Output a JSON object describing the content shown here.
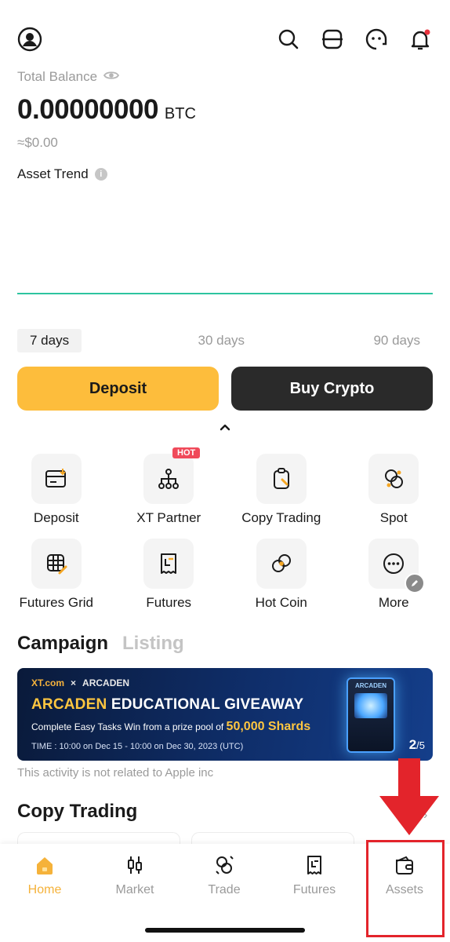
{
  "header": {
    "icons": [
      "profile-icon",
      "search-icon",
      "scan-icon",
      "support-icon",
      "notification-icon"
    ]
  },
  "balance": {
    "label": "Total Balance",
    "value": "0.00000000",
    "unit": "BTC",
    "fiat": "≈$0.00"
  },
  "trend": {
    "label": "Asset Trend",
    "info": "i",
    "ranges": [
      "7 days",
      "30 days",
      "90 days"
    ],
    "active_range": "7 days",
    "line_color": "#2ec4a0"
  },
  "actions": {
    "deposit": "Deposit",
    "buy": "Buy Crypto",
    "deposit_color": "#fdbd3c",
    "buy_color": "#2a2a2a"
  },
  "shortcuts": [
    {
      "label": "Deposit",
      "icon": "deposit-card-icon"
    },
    {
      "label": "XT Partner",
      "icon": "partner-network-icon",
      "badge": "HOT"
    },
    {
      "label": "Copy Trading",
      "icon": "copy-trading-icon"
    },
    {
      "label": "Spot",
      "icon": "spot-coins-icon"
    },
    {
      "label": "Futures Grid",
      "icon": "futures-grid-icon"
    },
    {
      "label": "Futures",
      "icon": "futures-icon"
    },
    {
      "label": "Hot Coin",
      "icon": "hot-coin-icon"
    },
    {
      "label": "More",
      "icon": "more-icon"
    }
  ],
  "sections": {
    "campaign": "Campaign",
    "listing": "Listing"
  },
  "banner": {
    "brand_left": "XT.com",
    "brand_sep": "×",
    "brand_right": "ARCADEN",
    "headline_a": "ARCADEN",
    "headline_b": " EDUCATIONAL GIVEAWAY",
    "sub_text": "Complete Easy Tasks  Win from a prize pool of ",
    "sub_big": "50,000 Shards",
    "time": "TIME : 10:00 on Dec 15 - 10:00 on Dec 30, 2023 (UTC)",
    "pager_current": "2",
    "pager_total": "/5",
    "machine_logo": "ARCADEN"
  },
  "disclaimer": "This activity is not related to Apple inc",
  "copy_trading": {
    "title": "Copy Trading",
    "more": "›"
  },
  "tabbar": {
    "items": [
      {
        "label": "Home",
        "icon": "home-icon",
        "active": true
      },
      {
        "label": "Market",
        "icon": "market-icon",
        "active": false
      },
      {
        "label": "Trade",
        "icon": "trade-icon",
        "active": false
      },
      {
        "label": "Futures",
        "icon": "futures-tab-icon",
        "active": false
      },
      {
        "label": "Assets",
        "icon": "wallet-icon",
        "active": false
      }
    ],
    "active_color": "#f5b23a"
  },
  "annotation": {
    "highlight_color": "#e3242b"
  }
}
